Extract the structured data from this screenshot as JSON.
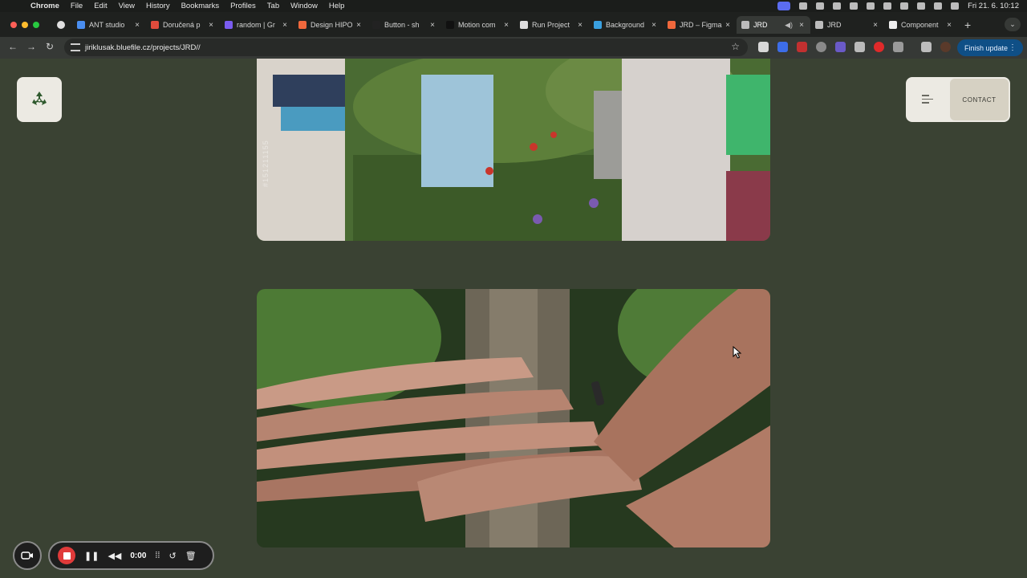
{
  "menubar": {
    "app": "Chrome",
    "items": [
      "File",
      "Edit",
      "View",
      "History",
      "Bookmarks",
      "Profiles",
      "Tab",
      "Window",
      "Help"
    ],
    "clock": "Fri 21. 6.  10:12"
  },
  "tabs": [
    {
      "label": "ANT studio",
      "color": "#4a8ef0"
    },
    {
      "label": "Doručená p",
      "color": "#e04b3c"
    },
    {
      "label": "random | Gr",
      "color": "#7a5cf0"
    },
    {
      "label": "Design HIPO",
      "color": "#f0683c"
    },
    {
      "label": "Button - sh",
      "color": "#222222"
    },
    {
      "label": "Motion com",
      "color": "#111111"
    },
    {
      "label": "Run Project",
      "color": "#dddddd"
    },
    {
      "label": "Background",
      "color": "#3aa0e0"
    },
    {
      "label": "JRD – Figma",
      "color": "#f0683c"
    },
    {
      "label": "JRD",
      "color": "#bcbcbc",
      "active": true
    },
    {
      "label": "JRD",
      "color": "#bcbcbc"
    },
    {
      "label": "Component",
      "color": "#eeeeee"
    }
  ],
  "toolbar": {
    "url": "jiriklusak.bluefile.cz/projects/JRD//",
    "update_label": "Finish update"
  },
  "page": {
    "contact_label": "CONTACT",
    "watermark": "#151211155"
  },
  "recorder": {
    "timer": "0:00"
  }
}
